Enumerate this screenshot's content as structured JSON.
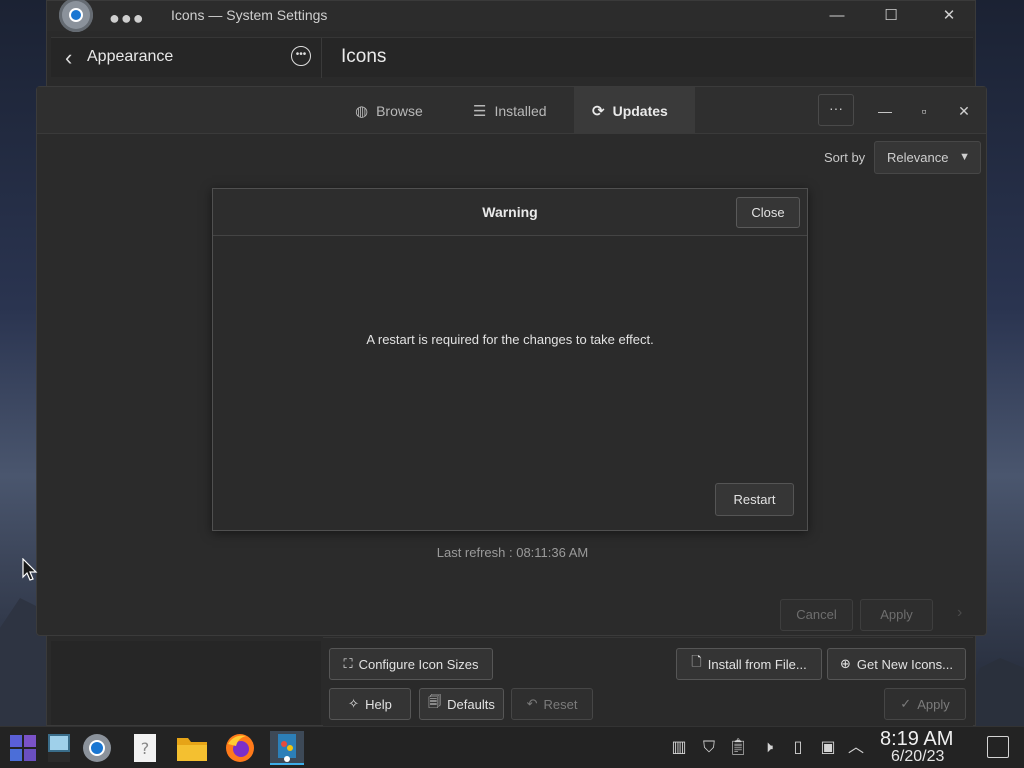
{
  "settings_window": {
    "title": "Icons — System Settings",
    "header": {
      "back_label": "Appearance",
      "page_title": "Icons"
    },
    "controls": {
      "minimize": "—",
      "maximize": "☐",
      "close": "✕"
    },
    "buttons": {
      "configure_icon_sizes": "Configure Icon Sizes",
      "install_from_file": "Install from File...",
      "get_new_icons": "Get New Icons...",
      "help": "Help",
      "defaults": "Defaults",
      "reset": "Reset",
      "apply": "Apply"
    }
  },
  "discover_window": {
    "tabs": [
      {
        "label": "Browse",
        "icon": "globe-icon"
      },
      {
        "label": "Installed",
        "icon": "list-icon"
      },
      {
        "label": "Updates",
        "icon": "refresh-icon",
        "active": true
      }
    ],
    "more_button": "···",
    "sort_label": "Sort by",
    "sort_value": "Relevance",
    "last_refresh": "Last refresh : 08:11:36 AM",
    "cancel_label": "Cancel",
    "apply_label": "Apply"
  },
  "dialog": {
    "title": "Warning",
    "close_label": "Close",
    "message": "A restart is required for the changes to take effect.",
    "restart_label": "Restart"
  },
  "taskbar": {
    "apps": [
      "start-menu-icon",
      "desktop-pager-icon",
      "system-settings-icon",
      "help-icon",
      "file-manager-icon",
      "firefox-icon",
      "discover-icon"
    ],
    "tray": [
      "sticky-notes-icon",
      "vault-icon",
      "clipboard-icon",
      "volume-muted-icon",
      "battery-icon",
      "network-icon",
      "expand-tray-icon"
    ],
    "time": "8:19 AM",
    "date": "6/20/23"
  },
  "colors": {
    "accent": "#3daee9",
    "window_bg": "#2b2b2b"
  }
}
